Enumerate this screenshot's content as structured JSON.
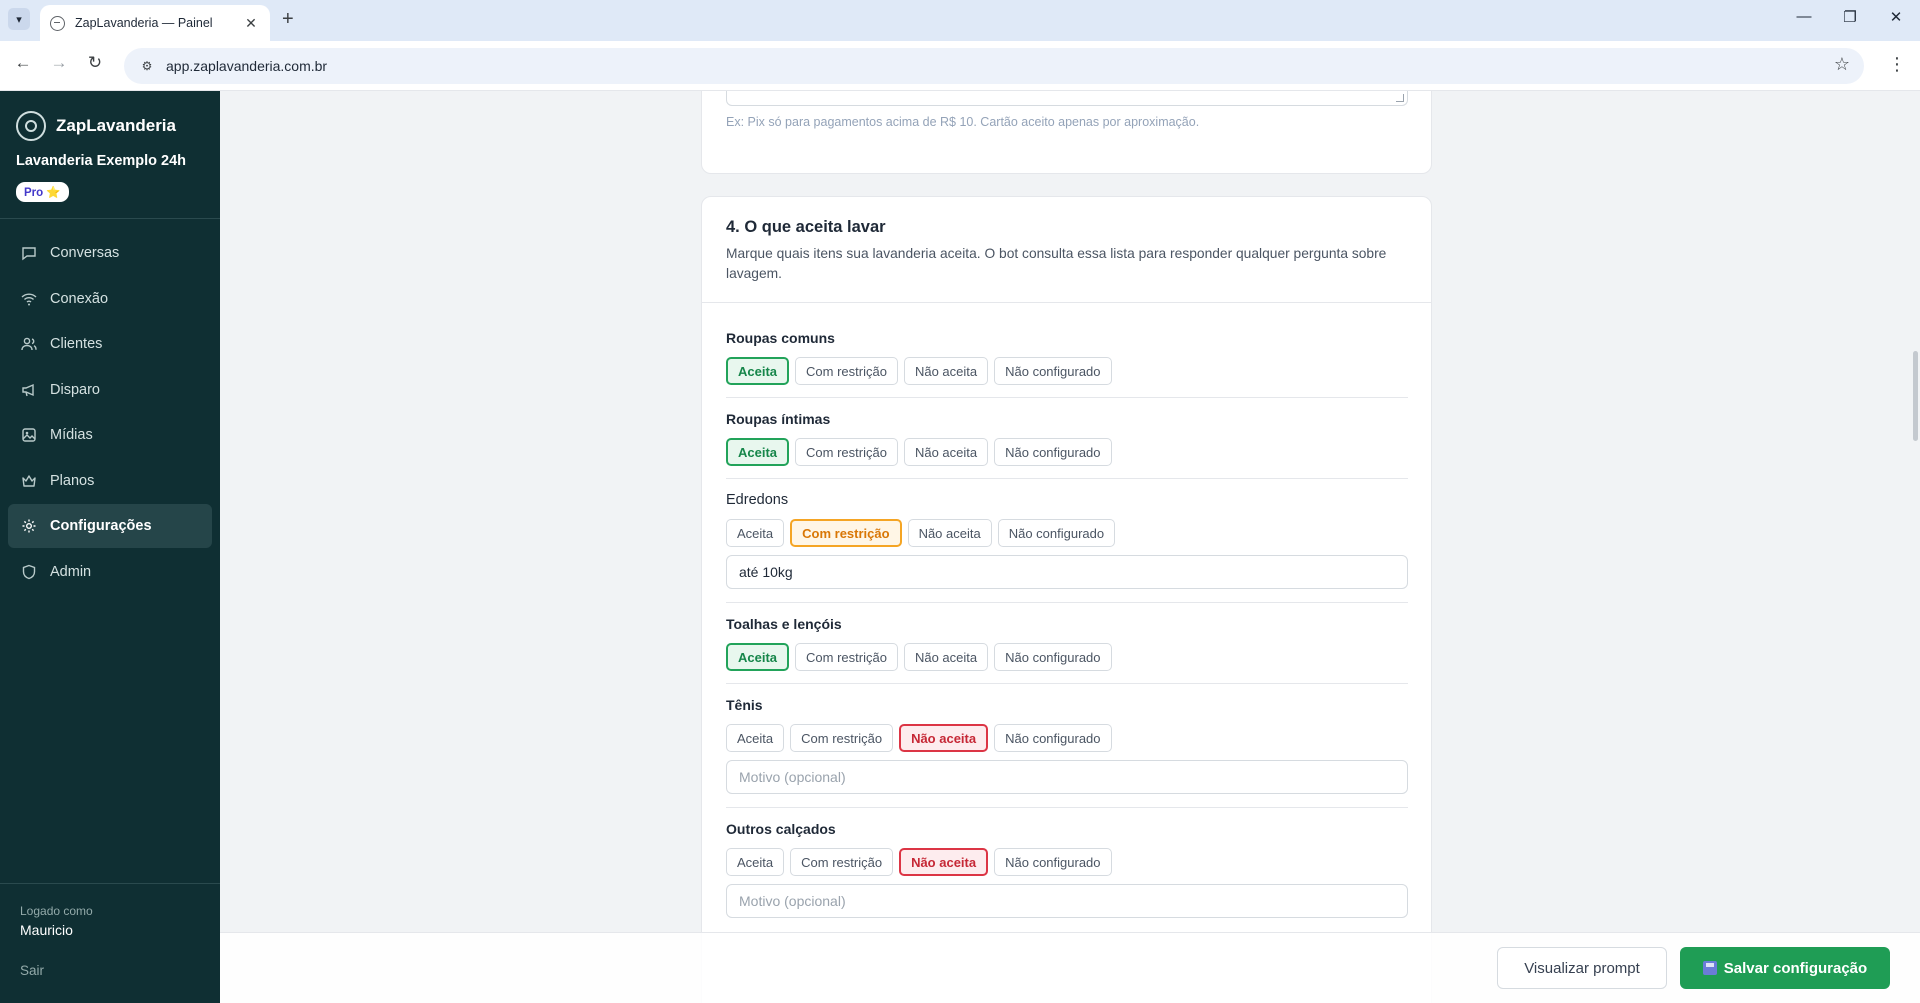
{
  "browser": {
    "tab_title": "ZapLavanderia — Painel",
    "url": "app.zaplavanderia.com.br"
  },
  "sidebar": {
    "brand": "ZapLavanderia",
    "laundry_name": "Lavanderia Exemplo 24h",
    "plan_badge": "Pro ⭐",
    "nav": [
      {
        "label": "Conversas",
        "icon": "chat-icon"
      },
      {
        "label": "Conexão",
        "icon": "wifi-icon"
      },
      {
        "label": "Clientes",
        "icon": "users-icon"
      },
      {
        "label": "Disparo",
        "icon": "megaphone-icon"
      },
      {
        "label": "Mídias",
        "icon": "media-icon"
      },
      {
        "label": "Planos",
        "icon": "crown-icon"
      },
      {
        "label": "Configurações",
        "icon": "gear-icon",
        "active": true
      },
      {
        "label": "Admin",
        "icon": "shield-icon"
      }
    ],
    "logged_label": "Logado como",
    "logged_user": "Mauricio",
    "logout": "Sair"
  },
  "payment_section": {
    "hint": "Ex: Pix só para pagamentos acima de R$ 10. Cartão aceito apenas por aproximação."
  },
  "wash_section": {
    "title": "4. O que aceita lavar",
    "description": "Marque quais itens sua lavanderia aceita. O bot consulta essa lista para responder qualquer pergunta sobre lavagem.",
    "options": [
      "Aceita",
      "Com restrição",
      "Não aceita",
      "Não configurado"
    ],
    "items": [
      {
        "label": "Roupas comuns",
        "selected": "Aceita"
      },
      {
        "label": "Roupas íntimas",
        "selected": "Aceita"
      },
      {
        "label": "Edredons",
        "selected": "Com restrição",
        "input_value": "até 10kg"
      },
      {
        "label": "Toalhas e lençóis",
        "selected": "Aceita"
      },
      {
        "label": "Tênis",
        "selected": "Não aceita",
        "input_placeholder": "Motivo (opcional)"
      },
      {
        "label": "Outros calçados",
        "selected": "Não aceita",
        "input_placeholder": "Motivo (opcional)"
      }
    ]
  },
  "actions": {
    "preview": "Visualizar prompt",
    "save": "Salvar configuração"
  },
  "colors": {
    "sidebar_bg": "#0f2f33",
    "accept": "#22a35a",
    "restrict": "#f5a524",
    "reject": "#dc3545",
    "save_button": "#1f9d55"
  }
}
